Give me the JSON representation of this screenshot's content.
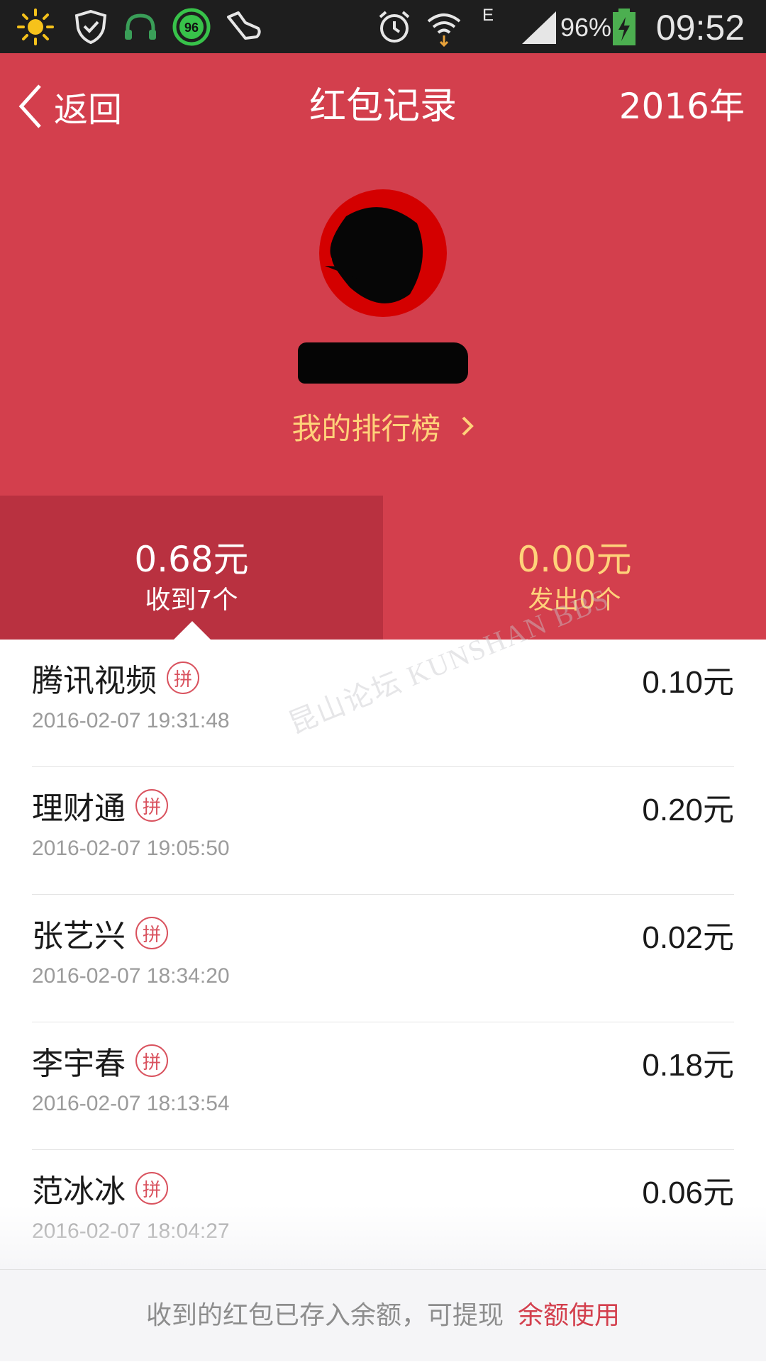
{
  "status_bar": {
    "battery_percent": "96%",
    "time": "09:52",
    "badge_number": "96",
    "network_label": "E",
    "icons": [
      "sun-icon",
      "shield-icon",
      "headphones-icon",
      "badge-96-icon",
      "shoe-icon",
      "alarm-icon",
      "wifi-icon",
      "signal-icon",
      "battery-icon"
    ]
  },
  "header": {
    "back_label": "返回",
    "title": "红包记录",
    "year": "2016年",
    "ranking_label": "我的排行榜",
    "colors": {
      "header_bg": "#d33f4d",
      "ranking_text": "#ffd27a"
    }
  },
  "summary": {
    "received": {
      "amount": "0.68元",
      "count": "收到7个"
    },
    "sent": {
      "amount": "0.00元",
      "count": "发出0个"
    }
  },
  "records": [
    {
      "name": "腾讯视频",
      "badge": "拼",
      "time": "2016-02-07 19:31:48",
      "amount": "0.10元"
    },
    {
      "name": "理财通",
      "badge": "拼",
      "time": "2016-02-07 19:05:50",
      "amount": "0.20元"
    },
    {
      "name": "张艺兴",
      "badge": "拼",
      "time": "2016-02-07 18:34:20",
      "amount": "0.02元"
    },
    {
      "name": "李宇春",
      "badge": "拼",
      "time": "2016-02-07 18:13:54",
      "amount": "0.18元"
    },
    {
      "name": "范冰冰",
      "badge": "拼",
      "time": "2016-02-07 18:04:27",
      "amount": "0.06元"
    }
  ],
  "footer": {
    "note": "收到的红包已存入余额，可提现",
    "link": "余额使用"
  },
  "watermark": "昆山论坛 KUNSHAN BBS"
}
